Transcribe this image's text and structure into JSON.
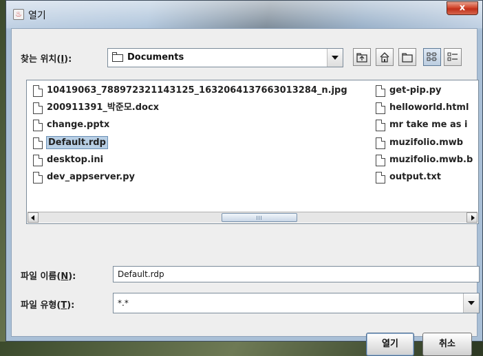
{
  "window": {
    "title": "열기",
    "close_label": "x"
  },
  "toolbar": {
    "look_in_label": "찾는 위치(",
    "look_in_mnemonic": "I",
    "look_in_suffix": "):",
    "look_in_value": "Documents",
    "buttons": [
      "up-one-level",
      "home",
      "new-folder",
      "list-view",
      "details-view"
    ]
  },
  "files": {
    "col1": [
      "10419063_788972321143125_1632064137663013284_n.jpg",
      "200911391_박준모.docx",
      "change.pptx",
      "Default.rdp",
      "desktop.ini",
      "dev_appserver.py"
    ],
    "col2": [
      "get-pip.py",
      "helloworld.html",
      "mr take me as i",
      "muzifolio.mwb",
      "muzifolio.mwb.b",
      "output.txt"
    ],
    "selected": "Default.rdp"
  },
  "filename": {
    "label": "파일 이름(",
    "mnemonic": "N",
    "suffix": "):",
    "value": "Default.rdp"
  },
  "filetype": {
    "label": "파일 유형(",
    "mnemonic": "T",
    "suffix": "):",
    "value": "*.*"
  },
  "buttons": {
    "open": "열기",
    "cancel": "취소"
  }
}
